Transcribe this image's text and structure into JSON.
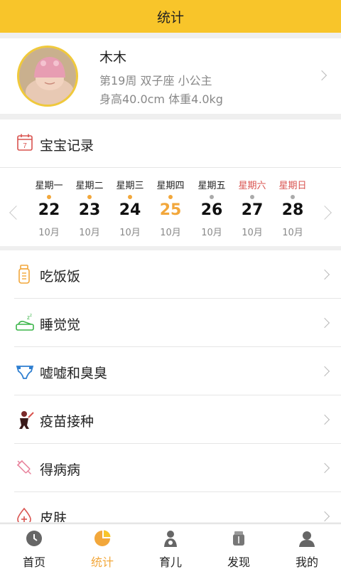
{
  "header": {
    "title": "统计"
  },
  "profile": {
    "name": "木木",
    "line1": "第19周 双子座 小公主",
    "line2": "身高40.0cm 体重4.0kg"
  },
  "record": {
    "icon_text": "7",
    "title": "宝宝记录",
    "days": [
      {
        "weekday": "星期一",
        "date": "22",
        "month": "10月",
        "weekend": false,
        "today": false,
        "dot": "#f2a73b"
      },
      {
        "weekday": "星期二",
        "date": "23",
        "month": "10月",
        "weekend": false,
        "today": false,
        "dot": "#f2a73b"
      },
      {
        "weekday": "星期三",
        "date": "24",
        "month": "10月",
        "weekend": false,
        "today": false,
        "dot": "#f2a73b"
      },
      {
        "weekday": "星期四",
        "date": "25",
        "month": "10月",
        "weekend": false,
        "today": true,
        "dot": "#f2a73b"
      },
      {
        "weekday": "星期五",
        "date": "26",
        "month": "10月",
        "weekend": false,
        "today": false,
        "dot": "#aaaaaa"
      },
      {
        "weekday": "星期六",
        "date": "27",
        "month": "10月",
        "weekend": true,
        "today": false,
        "dot": "#aaaaaa"
      },
      {
        "weekday": "星期日",
        "date": "28",
        "month": "10月",
        "weekend": true,
        "today": false,
        "dot": "#aaaaaa"
      }
    ]
  },
  "menu": {
    "items": [
      {
        "label": "吃饭饭",
        "icon": "bottle-icon"
      },
      {
        "label": "睡觉觉",
        "icon": "bed-icon"
      },
      {
        "label": "嘘嘘和臭臭",
        "icon": "diaper-icon"
      },
      {
        "label": "疫苗接种",
        "icon": "vaccine-icon"
      },
      {
        "label": "得病病",
        "icon": "syringe-icon"
      },
      {
        "label": "皮肤",
        "icon": "skin-drop-icon"
      }
    ]
  },
  "tabbar": {
    "tabs": [
      {
        "label": "首页",
        "icon": "clock-icon",
        "active": false
      },
      {
        "label": "统计",
        "icon": "pie-chart-icon",
        "active": true
      },
      {
        "label": "育儿",
        "icon": "mother-baby-icon",
        "active": false
      },
      {
        "label": "发现",
        "icon": "discover-icon",
        "active": false
      },
      {
        "label": "我的",
        "icon": "user-icon",
        "active": false
      }
    ]
  },
  "colors": {
    "accent": "#f8c52a",
    "today": "#f2a73b",
    "weekend": "#d9534f",
    "active_tab": "#f2a73b"
  }
}
